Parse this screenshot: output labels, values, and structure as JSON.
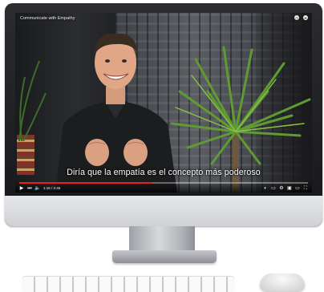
{
  "video": {
    "title": "Communicate with Empathy",
    "subtitle": "Diría que la empatía es el concepto más poderoso",
    "time_display": "1:16 / 2:46",
    "progress_fraction": 0.46
  },
  "icons": {
    "top_right": [
      "clock-icon",
      "share-icon"
    ],
    "controls_left": [
      "play-icon",
      "next-icon",
      "volume-icon"
    ],
    "controls_right": [
      "autoplay-toggle-icon",
      "subtitles-icon",
      "settings-icon",
      "miniplayer-icon",
      "theater-icon",
      "fullscreen-icon"
    ]
  },
  "colors": {
    "progress": "#e62117",
    "subtitle_text": "#ffffff"
  }
}
